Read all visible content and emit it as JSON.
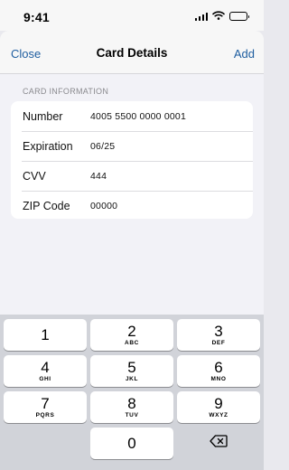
{
  "status_bar": {
    "time": "9:41"
  },
  "nav": {
    "close_label": "Close",
    "title": "Card Details",
    "add_label": "Add"
  },
  "section": {
    "header": "CARD INFORMATION"
  },
  "fields": [
    {
      "label": "Number",
      "value": "4005 5500 0000 0001"
    },
    {
      "label": "Expiration",
      "value": "06/25"
    },
    {
      "label": "CVV",
      "value": "444"
    },
    {
      "label": "ZIP Code",
      "value": "00000"
    }
  ],
  "keypad": [
    {
      "num": "1",
      "letters": ""
    },
    {
      "num": "2",
      "letters": "ABC"
    },
    {
      "num": "3",
      "letters": "DEF"
    },
    {
      "num": "4",
      "letters": "GHI"
    },
    {
      "num": "5",
      "letters": "JKL"
    },
    {
      "num": "6",
      "letters": "MNO"
    },
    {
      "num": "7",
      "letters": "PQRS"
    },
    {
      "num": "8",
      "letters": "TUV"
    },
    {
      "num": "9",
      "letters": "WXYZ"
    },
    {
      "num": "0",
      "letters": ""
    }
  ],
  "colors": {
    "accent": "#1f5ea0",
    "background": "#f2f2f7",
    "keyboard": "#d1d3d9"
  }
}
